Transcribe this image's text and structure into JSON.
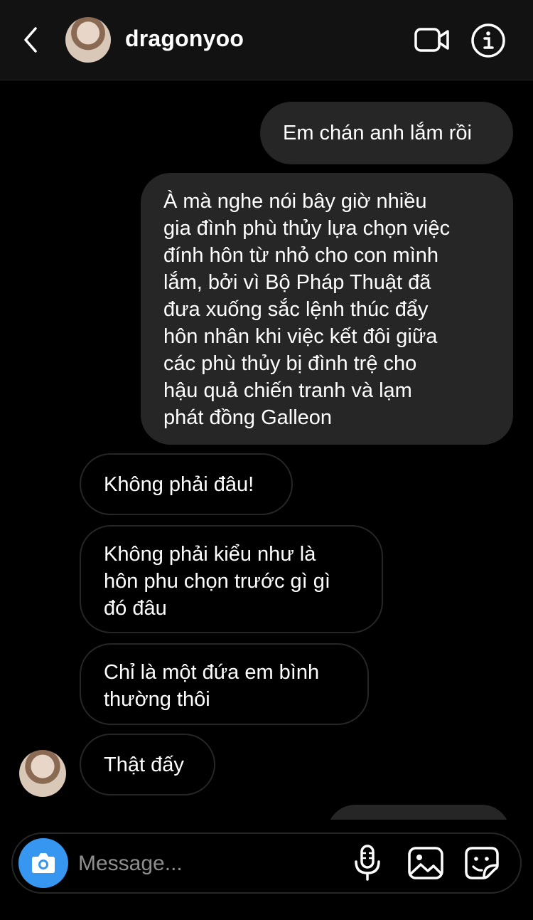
{
  "header": {
    "username": "dragonyoo",
    "icons": {
      "back": "chevron-left-icon",
      "video": "video-camera-icon",
      "info": "info-icon"
    }
  },
  "messages": [
    {
      "direction": "outgoing",
      "lines": [
        "Em chán anh lắm rồi"
      ]
    },
    {
      "direction": "outgoing",
      "lines": [
        "À mà nghe nói bây giờ nhiều",
        "gia đình phù thủy lựa chọn việc",
        "đính hôn từ nhỏ cho con mình",
        "lắm, bởi vì Bộ Pháp Thuật đã",
        "đưa xuống sắc lệnh thúc đẩy",
        "hôn nhân khi việc kết đôi giữa",
        "các phù thủy bị đình trệ cho",
        "hậu quả chiến tranh và lạm",
        "phát đồng Galleon"
      ]
    },
    {
      "direction": "incoming",
      "lines": [
        "Không phải đâu!"
      ]
    },
    {
      "direction": "incoming",
      "lines": [
        "Không phải kiểu như là",
        "hôn phu chọn trước gì gì",
        "đó đâu"
      ]
    },
    {
      "direction": "incoming",
      "lines": [
        "Chỉ là một đứa em bình",
        "thường thôi"
      ]
    },
    {
      "direction": "incoming",
      "lines": [
        "Thật đấy"
      ]
    }
  ],
  "composer": {
    "placeholder": "Message...",
    "icons": {
      "camera": "camera-icon",
      "mic": "microphone-icon",
      "gallery": "image-icon",
      "sticker": "sticker-icon"
    }
  },
  "colors": {
    "background": "#000000",
    "header": "#121212",
    "outgoing_bubble": "#262626",
    "incoming_border": "#262626",
    "accent": "#3797f0",
    "placeholder": "#8e8e8e"
  }
}
